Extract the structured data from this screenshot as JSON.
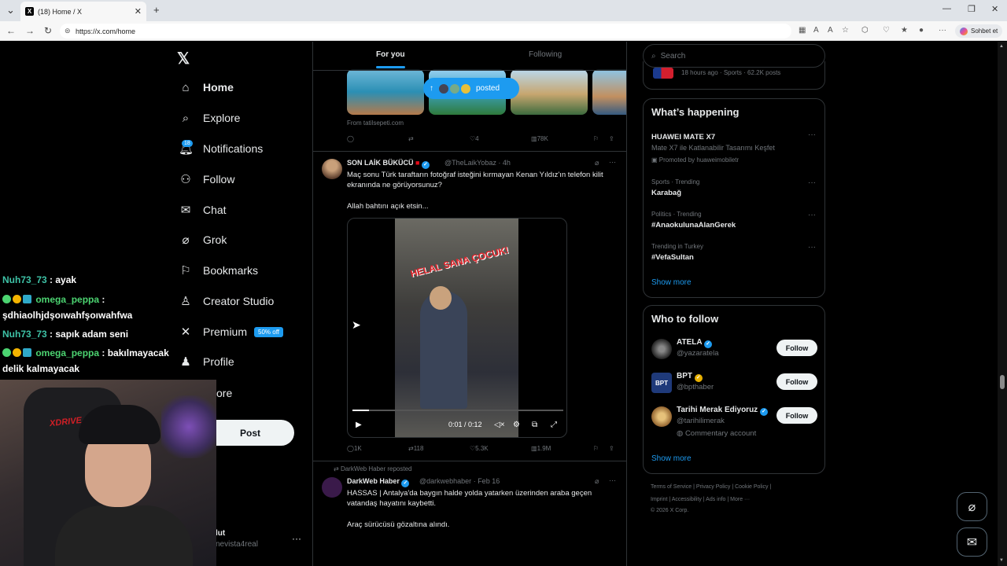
{
  "browser": {
    "tab_title": "(18) Home / X",
    "url": "https://x.com/home",
    "sohbet_label": "Sohbet et"
  },
  "sidebar": {
    "items": [
      {
        "label": "Home",
        "icon": "home-icon"
      },
      {
        "label": "Explore",
        "icon": "search-icon"
      },
      {
        "label": "Notifications",
        "icon": "bell-icon"
      },
      {
        "label": "Follow",
        "icon": "add-user-icon"
      },
      {
        "label": "Chat",
        "icon": "mail-icon"
      },
      {
        "label": "Grok",
        "icon": "grok-icon"
      },
      {
        "label": "Bookmarks",
        "icon": "bookmark-icon"
      },
      {
        "label": "Creator Studio",
        "icon": "creator-icon"
      },
      {
        "label": "Premium",
        "icon": "x-icon"
      },
      {
        "label": "Profile",
        "icon": "person-icon"
      },
      {
        "label": "ore",
        "icon": "more-icon"
      }
    ],
    "notif_badge": "18",
    "premium_badge": "50% off",
    "post_label": "Post",
    "profile_name": "lut",
    "profile_handle": "nevista4real"
  },
  "feed": {
    "tab_foryou": "For you",
    "tab_following": "Following",
    "posted_label": "posted",
    "from_source": "From tatilsepeti.com",
    "prev_actions": {
      "likes": "4",
      "views": "78K"
    },
    "tweet1": {
      "name": "SON LAİK BÜKÜCÜ",
      "handle": "@TheLaikYobaz",
      "time": "4h",
      "text1": "Maç sonu Türk taraftarın fotoğraf isteğini kırmayan Kenan Yıldız'ın telefon kilit ekranında ne görüyorsunuz?",
      "text2": "Allah bahtını açık etsin...",
      "video_caption": "HELAL SANA ÇOCUK!",
      "video_time": "0:01 / 0:12",
      "progress": 0.08,
      "replies": "1K",
      "reposts": "118",
      "likes": "5.3K",
      "views": "1.9M"
    },
    "tweet2": {
      "reposted_by": "DarkWeb Haber reposted",
      "name": "DarkWeb Haber",
      "handle": "@darkwebhaber",
      "time": "Feb 16",
      "text1": "HASSAS | Antalya'da baygın halde yolda yatarken üzerinden araba geçen vatandaş hayatını kaybetti.",
      "text2": "Araç sürücüsü gözaltına alındı."
    }
  },
  "right": {
    "search_placeholder": "Search",
    "top_trend_meta": "18 hours ago · Sports · 62.2K posts",
    "whats_happening": "What’s happening",
    "trends": [
      {
        "category": "",
        "name": "HUAWEI MATE X7",
        "sub": "Mate X7 ile Katlanabilir Tasarımı Keşfet",
        "promo": "Promoted by huaweimobiletr"
      },
      {
        "category": "Sports · Trending",
        "name": "Karabağ"
      },
      {
        "category": "Politics · Trending",
        "name": "#AnaokulunaAlanGerek"
      },
      {
        "category": "Trending in Turkey",
        "name": "#VefaSultan"
      }
    ],
    "show_more": "Show more",
    "who_to_follow": "Who to follow",
    "follow_label": "Follow",
    "accounts": [
      {
        "name": "ATELA",
        "handle": "@yazaratela",
        "sub": ""
      },
      {
        "name": "BPT",
        "handle": "@bpthaber",
        "sub": ""
      },
      {
        "name": "Tarihi Merak Ediyoruz",
        "handle": "@tarihilimerak",
        "sub": "Commentary account"
      }
    ],
    "footer1": "Terms of Service  |  Privacy Policy  |  Cookie Policy  |",
    "footer2": "Imprint  |  Accessibility  |  Ads info  |  More ···",
    "footer3": "© 2026 X Corp."
  },
  "overlay": {
    "chat": [
      {
        "user": "Nuh73_73",
        "msg": ": ayak"
      },
      {
        "user": "omega_peppa",
        "msg": ":"
      },
      {
        "user": "",
        "msg": "şdhiaolhjdşoıwahfşoıwahfwa"
      },
      {
        "user": "Nuh73_73",
        "msg": ": sapık adam seni"
      },
      {
        "user": "omega_peppa",
        "msg": ": bakılmayacak"
      },
      {
        "user": "",
        "msg": "delik kalmayacak"
      }
    ],
    "chair_text": "XDRIVE"
  }
}
